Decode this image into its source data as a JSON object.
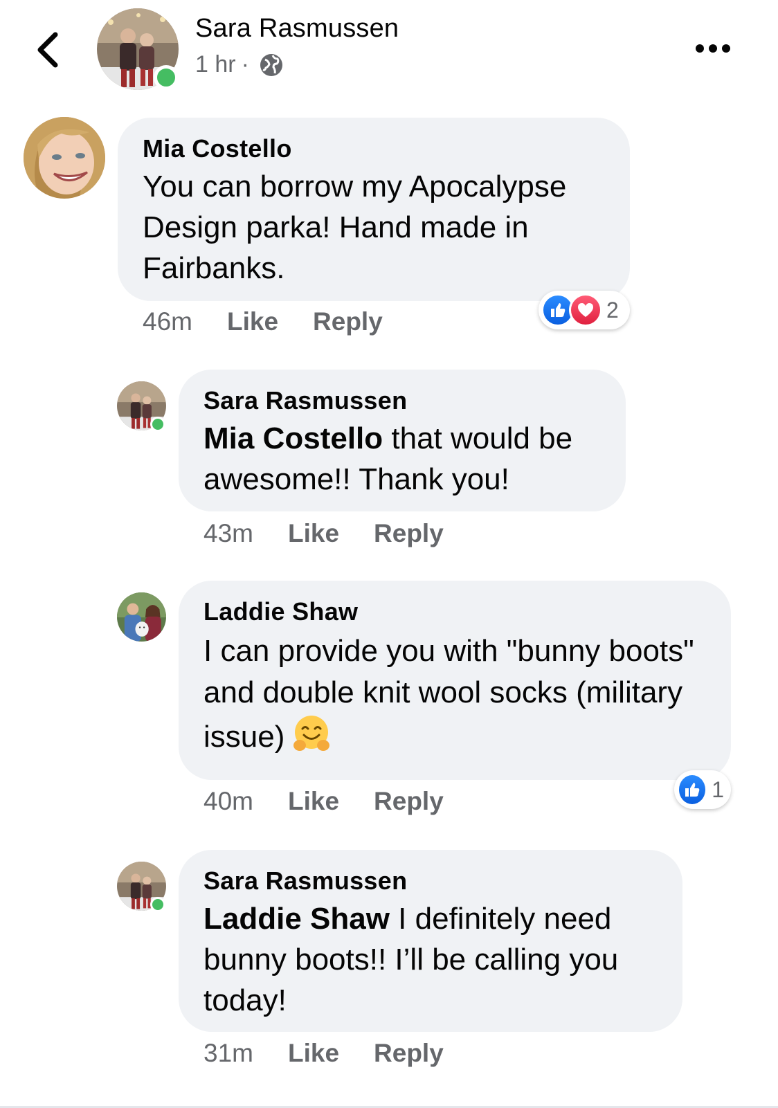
{
  "header": {
    "name": "Sara Rasmussen",
    "time": "1 hr",
    "separator": "·"
  },
  "comments": [
    {
      "author": "Mia Costello",
      "tag": "",
      "text": "You can borrow my Apocalypse Design parka! Hand made in Fairbanks.",
      "time": "46m",
      "like_label": "Like",
      "reply_label": "Reply",
      "reaction_count": "2"
    },
    {
      "author": "Sara Rasmussen",
      "tag": "Mia Costello",
      "text": " that would be awesome!! Thank you!",
      "time": "43m",
      "like_label": "Like",
      "reply_label": "Reply"
    },
    {
      "author": "Laddie Shaw",
      "tag": "",
      "text": "I can provide you with \"bunny boots\" and double knit wool socks (military issue)",
      "emoji": "hugging-face-emoji",
      "time": "40m",
      "like_label": "Like",
      "reply_label": "Reply",
      "reaction_count": "1"
    },
    {
      "author": "Sara Rasmussen",
      "tag": "Laddie Shaw",
      "text": " I definitely need bunny boots!! I’ll be calling you today!",
      "time": "31m",
      "like_label": "Like",
      "reply_label": "Reply"
    }
  ],
  "colors": {
    "bubble": "#f0f2f5",
    "meta_text": "#65676b",
    "presence": "#45bd62",
    "like_blue": "#1877f2",
    "love_red": "#f02849"
  }
}
